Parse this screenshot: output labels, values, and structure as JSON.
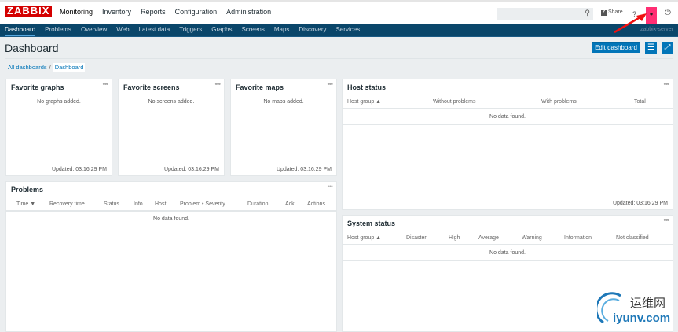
{
  "header": {
    "logo": "ZABBIX",
    "menu": [
      "Monitoring",
      "Inventory",
      "Reports",
      "Configuration",
      "Administration"
    ],
    "share": "Share",
    "help": "?",
    "search_placeholder": ""
  },
  "nav": {
    "items": [
      "Dashboard",
      "Problems",
      "Overview",
      "Web",
      "Latest data",
      "Triggers",
      "Graphs",
      "Screens",
      "Maps",
      "Discovery",
      "Services"
    ],
    "server": "zabbix-server"
  },
  "page": {
    "title": "Dashboard",
    "edit": "Edit dashboard",
    "breadcrumb": [
      "All dashboards",
      "Dashboard"
    ]
  },
  "widgets": {
    "fav_graphs": {
      "title": "Favorite graphs",
      "empty": "No graphs added.",
      "updated": "Updated: 03:16:29 PM"
    },
    "fav_screens": {
      "title": "Favorite screens",
      "empty": "No screens added.",
      "updated": "Updated: 03:16:29 PM"
    },
    "fav_maps": {
      "title": "Favorite maps",
      "empty": "No maps added.",
      "updated": "Updated: 03:16:29 PM"
    },
    "host_status": {
      "title": "Host status",
      "columns": [
        "Host group ▲",
        "Without problems",
        "With problems",
        "Total"
      ],
      "empty": "No data found.",
      "updated": "Updated: 03:16:29 PM"
    },
    "problems": {
      "title": "Problems",
      "columns": [
        "Time ▼",
        "Recovery time",
        "Status",
        "Info",
        "Host",
        "Problem • Severity",
        "Duration",
        "Ack",
        "Actions"
      ],
      "empty": "No data found."
    },
    "system_status": {
      "title": "System status",
      "columns": [
        "Host group ▲",
        "Disaster",
        "High",
        "Average",
        "Warning",
        "Information",
        "Not classified"
      ],
      "empty": "No data found."
    }
  },
  "watermark": {
    "cn": "运维网",
    "en": "iyunv.com"
  },
  "colors": {
    "nav": "#0a466a",
    "accent": "#0275b8",
    "logo": "#d40000",
    "user": "#ff2e73"
  }
}
